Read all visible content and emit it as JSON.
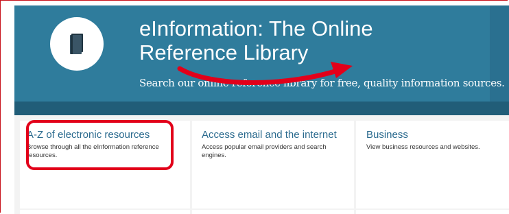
{
  "header": {
    "title_line1": "eInformation: The Online",
    "title_line2": "Reference Library",
    "subtitle": "Search our online reference library for free, quality information sources.",
    "logo_icon": "book-icon"
  },
  "cards": [
    {
      "title": "A-Z of electronic resources",
      "description": "Browse through all the eInformation reference resources."
    },
    {
      "title": "Access email and the internet",
      "description": "Access popular email providers and search engines."
    },
    {
      "title": "Business",
      "description": "View business resources and websites."
    }
  ],
  "colors": {
    "header_bg": "#2f7c9c",
    "header_band": "#215d78",
    "link": "#2a6a8e",
    "annotation": "#e2001a"
  }
}
